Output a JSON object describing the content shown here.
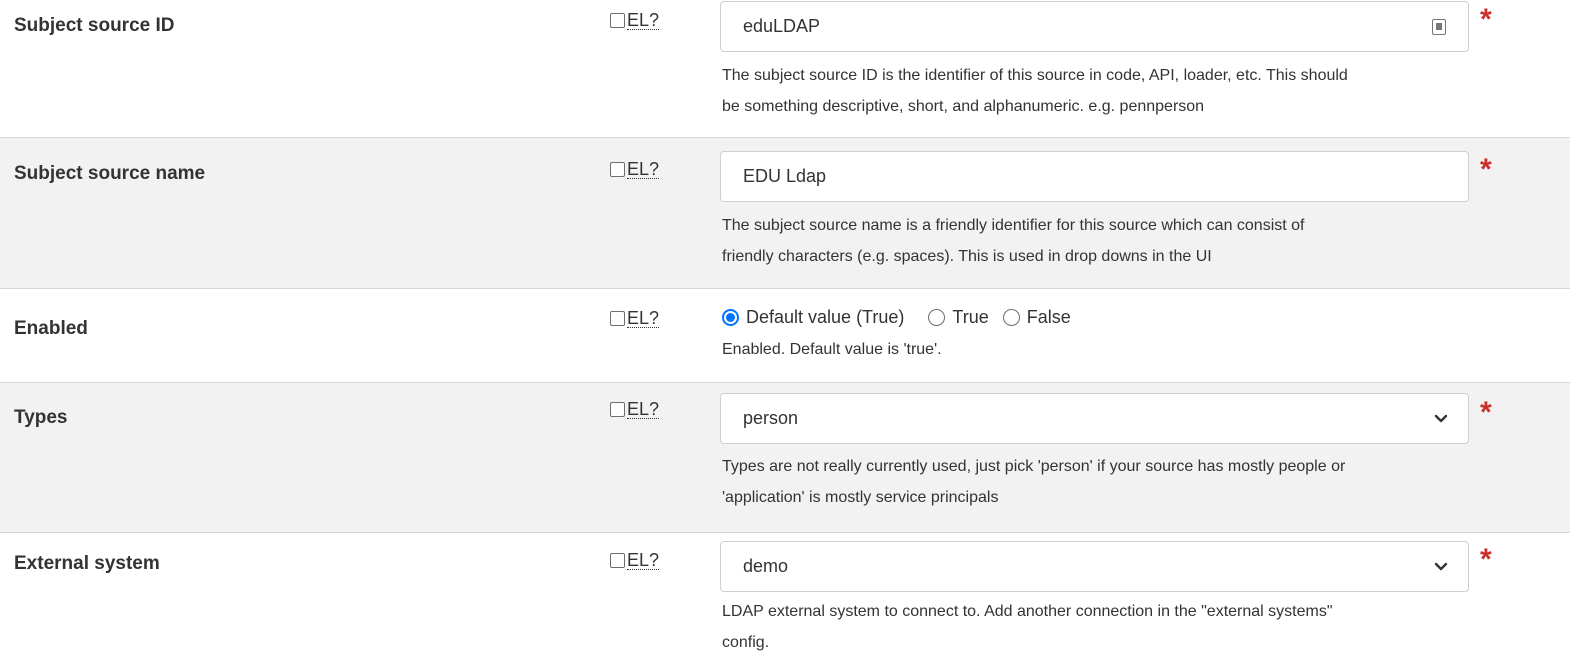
{
  "el_label": "EL?",
  "required_mark": "*",
  "rows": [
    {
      "label": "Subject source ID",
      "value": "eduLDAP",
      "help_lines": [
        "The subject source ID is the identifier of this source in code, API, loader, etc. This should",
        "be something descriptive, short, and alphanumeric. e.g. pennperson"
      ]
    },
    {
      "label": "Subject source name",
      "value": "EDU Ldap",
      "help_lines": [
        "The subject source name is a friendly identifier for this source which can consist of",
        "friendly characters (e.g. spaces). This is used in drop downs in the UI"
      ]
    },
    {
      "label": "Enabled",
      "options": [
        "Default value (True)",
        "True",
        "False"
      ],
      "selected": "Default value (True)",
      "help_lines": [
        "Enabled. Default value is 'true'."
      ]
    },
    {
      "label": "Types",
      "value": "person",
      "help_lines": [
        "Types are not really currently used, just pick 'person' if your source has mostly people or",
        "'application' is mostly service principals"
      ]
    },
    {
      "label": "External system",
      "value": "demo",
      "help_lines": [
        "LDAP external system to connect to. Add another connection in the \"external systems\"",
        "config."
      ]
    }
  ],
  "colors": {
    "required": "#c9302c",
    "radio_accent": "#0075ff",
    "shaded_row": "#f2f2f2"
  }
}
